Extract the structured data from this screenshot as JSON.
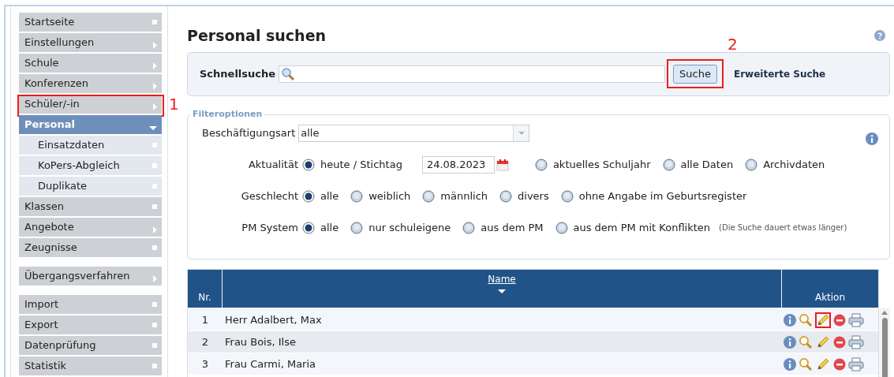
{
  "sidebar": {
    "groups": [
      [
        {
          "label": "Startseite",
          "kind": "leaf",
          "selected": false
        },
        {
          "label": "Einstellungen",
          "kind": "menu",
          "selected": false
        },
        {
          "label": "Schule",
          "kind": "menu",
          "selected": false
        },
        {
          "label": "Konferenzen",
          "kind": "menu",
          "selected": false
        },
        {
          "label": "Schüler/-in",
          "kind": "menu",
          "selected": false,
          "callout": "1"
        },
        {
          "label": "Personal",
          "kind": "open",
          "selected": true
        },
        {
          "label": "Einsatzdaten",
          "kind": "sub",
          "selected": false
        },
        {
          "label": "KoPers-Abgleich",
          "kind": "sub",
          "selected": false
        },
        {
          "label": "Duplikate",
          "kind": "sub",
          "selected": false
        },
        {
          "label": "Klassen",
          "kind": "leaf",
          "selected": false
        },
        {
          "label": "Angebote",
          "kind": "menu",
          "selected": false
        },
        {
          "label": "Zeugnisse",
          "kind": "leaf",
          "selected": false
        }
      ],
      [
        {
          "label": "Übergangsverfahren",
          "kind": "menu",
          "selected": false
        }
      ],
      [
        {
          "label": "Import",
          "kind": "leaf",
          "selected": false
        },
        {
          "label": "Export",
          "kind": "leaf",
          "selected": false
        },
        {
          "label": "Datenprüfung",
          "kind": "leaf",
          "selected": false
        },
        {
          "label": "Statistik",
          "kind": "leaf",
          "selected": false
        }
      ]
    ]
  },
  "page_title": "Personal suchen",
  "quick_search": {
    "label": "Schnellsuche",
    "button": "Suche",
    "button_callout": "2",
    "advanced_link": "Erweiterte Suche"
  },
  "filters": {
    "legend": "Filteroptionen",
    "rows": [
      {
        "kind": "select",
        "label": "Beschäftigungsart",
        "value": "alle"
      },
      {
        "kind": "radios",
        "label": "Aktualität",
        "options": [
          {
            "label": "heute / Stichtag",
            "selected": true,
            "date": "24.08.2023"
          },
          {
            "label": "aktuelles Schuljahr",
            "selected": false
          },
          {
            "label": "alle Daten",
            "selected": false
          },
          {
            "label": "Archivdaten",
            "selected": false
          }
        ]
      },
      {
        "kind": "radios",
        "label": "Geschlecht",
        "options": [
          {
            "label": "alle",
            "selected": true
          },
          {
            "label": "weiblich",
            "selected": false
          },
          {
            "label": "männlich",
            "selected": false
          },
          {
            "label": "divers",
            "selected": false
          },
          {
            "label": "ohne Angabe im Geburtsregister",
            "selected": false
          }
        ]
      },
      {
        "kind": "radios",
        "label": "PM System",
        "options": [
          {
            "label": "alle",
            "selected": true
          },
          {
            "label": "nur schuleigene",
            "selected": false
          },
          {
            "label": "aus dem PM",
            "selected": false
          },
          {
            "label": "aus dem PM mit Konflikten",
            "selected": false
          }
        ],
        "note": "(Die Suche dauert etwas länger)"
      }
    ]
  },
  "table": {
    "columns": [
      "Nr.",
      "Name",
      "Aktion"
    ],
    "rows": [
      {
        "nr": "1",
        "name": "Herr Adalbert, Max",
        "edit_highlighted": true
      },
      {
        "nr": "2",
        "name": "Frau Bois, Ilse",
        "edit_highlighted": false
      },
      {
        "nr": "3",
        "name": "Frau Carmi, Maria",
        "edit_highlighted": false
      }
    ]
  }
}
